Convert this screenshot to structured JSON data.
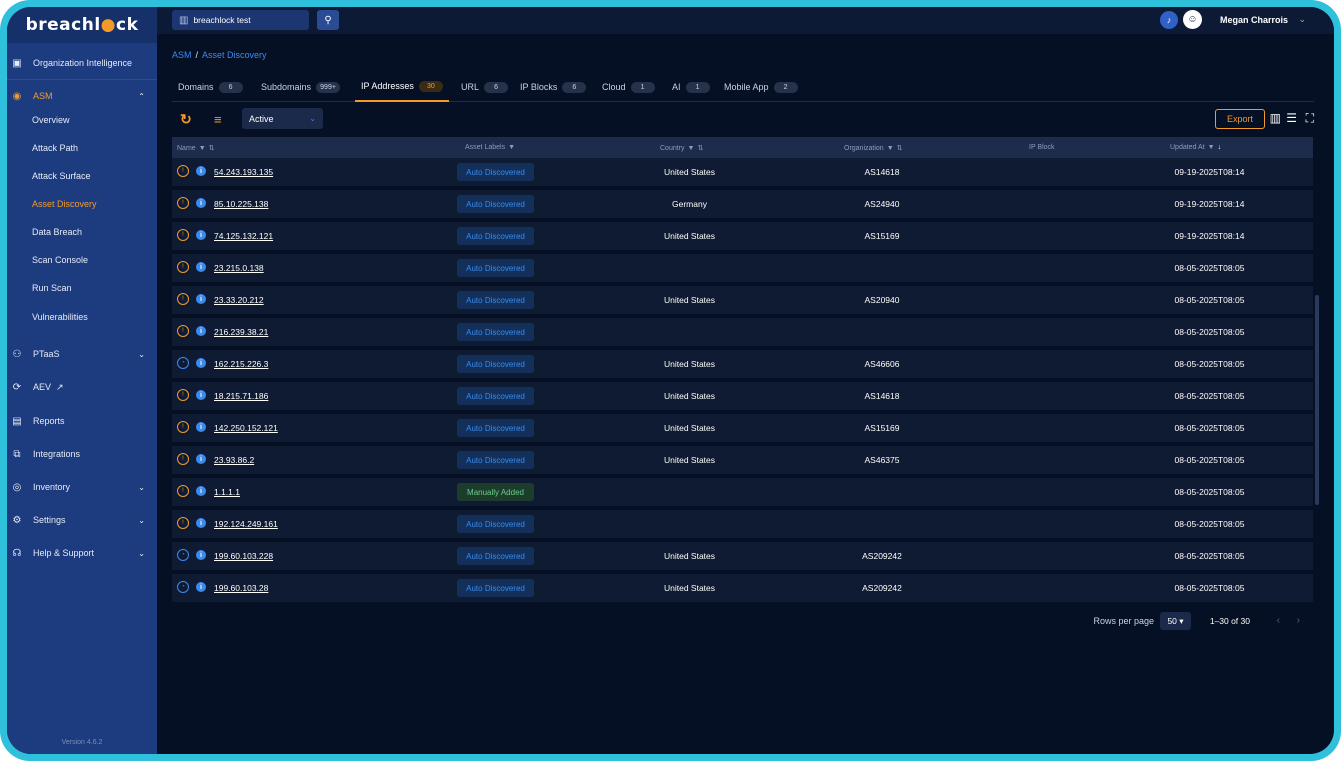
{
  "app": {
    "brand_prefix": "breachl",
    "brand_lock": "●",
    "brand_suffix": "ck"
  },
  "sidebar": {
    "org_intel": "Organization Intelligence",
    "asm": "ASM",
    "asm_items": [
      "Overview",
      "Attack Path",
      "Attack Surface",
      "Asset Discovery",
      "Data Breach",
      "Scan Console",
      "Run Scan",
      "Vulnerabilities"
    ],
    "ptaas": "PTaaS",
    "aev": "AEV",
    "reports": "Reports",
    "integrations": "Integrations",
    "inventory": "Inventory",
    "settings": "Settings",
    "help": "Help & Support",
    "version": "Version 4.6.2"
  },
  "topbar": {
    "org": "breachlock test",
    "user": "Megan Charrois"
  },
  "breadcrumb": {
    "root": "ASM",
    "separator": "/",
    "current": "Asset Discovery"
  },
  "tabs": [
    {
      "label": "Domains",
      "count": "6"
    },
    {
      "label": "Subdomains",
      "count": "999+"
    },
    {
      "label": "IP Addresses",
      "count": "30"
    },
    {
      "label": "URL",
      "count": "6"
    },
    {
      "label": "IP Blocks",
      "count": "6"
    },
    {
      "label": "Cloud",
      "count": "1"
    },
    {
      "label": "AI",
      "count": "1"
    },
    {
      "label": "Mobile App",
      "count": "2"
    }
  ],
  "toolbar": {
    "status": "Active",
    "export": "Export"
  },
  "columns": {
    "name": "Name",
    "labels": "Asset Labels",
    "country": "Country",
    "organization": "Organization",
    "ip_block": "IP Block",
    "updated": "Updated At"
  },
  "rows": [
    {
      "severity": "high",
      "ip": "54.243.193.135",
      "label": "Auto Discovered",
      "country": "United States",
      "org": "AS14618",
      "updated": "09-19-2025T08:14"
    },
    {
      "severity": "high",
      "ip": "85.10.225.138",
      "label": "Auto Discovered",
      "country": "Germany",
      "org": "AS24940",
      "updated": "09-19-2025T08:14"
    },
    {
      "severity": "high",
      "ip": "74.125.132.121",
      "label": "Auto Discovered",
      "country": "United States",
      "org": "AS15169",
      "updated": "09-19-2025T08:14"
    },
    {
      "severity": "high",
      "ip": "23.215.0.138",
      "label": "Auto Discovered",
      "country": "",
      "org": "",
      "updated": "08-05-2025T08:05"
    },
    {
      "severity": "high",
      "ip": "23.33.20.212",
      "label": "Auto Discovered",
      "country": "United States",
      "org": "AS20940",
      "updated": "08-05-2025T08:05"
    },
    {
      "severity": "high",
      "ip": "216.239.38.21",
      "label": "Auto Discovered",
      "country": "",
      "org": "",
      "updated": "08-05-2025T08:05"
    },
    {
      "severity": "low",
      "ip": "162.215.226.3",
      "label": "Auto Discovered",
      "country": "United States",
      "org": "AS46606",
      "updated": "08-05-2025T08:05"
    },
    {
      "severity": "high",
      "ip": "18.215.71.186",
      "label": "Auto Discovered",
      "country": "United States",
      "org": "AS14618",
      "updated": "08-05-2025T08:05"
    },
    {
      "severity": "high",
      "ip": "142.250.152.121",
      "label": "Auto Discovered",
      "country": "United States",
      "org": "AS15169",
      "updated": "08-05-2025T08:05"
    },
    {
      "severity": "high",
      "ip": "23.93.86.2",
      "label": "Auto Discovered",
      "country": "United States",
      "org": "AS46375",
      "updated": "08-05-2025T08:05"
    },
    {
      "severity": "high",
      "ip": "1.1.1.1",
      "label": "Manually Added",
      "country": "",
      "org": "",
      "updated": "08-05-2025T08:05"
    },
    {
      "severity": "high",
      "ip": "192.124.249.161",
      "label": "Auto Discovered",
      "country": "",
      "org": "",
      "updated": "08-05-2025T08:05"
    },
    {
      "severity": "low",
      "ip": "199.60.103.228",
      "label": "Auto Discovered",
      "country": "United States",
      "org": "AS209242",
      "updated": "08-05-2025T08:05"
    },
    {
      "severity": "low",
      "ip": "199.60.103.28",
      "label": "Auto Discovered",
      "country": "United States",
      "org": "AS209242",
      "updated": "08-05-2025T08:05"
    }
  ],
  "pagination": {
    "rows_per_page_label": "Rows per page",
    "rows_per_page": "50",
    "range": "1–30 of 30"
  }
}
